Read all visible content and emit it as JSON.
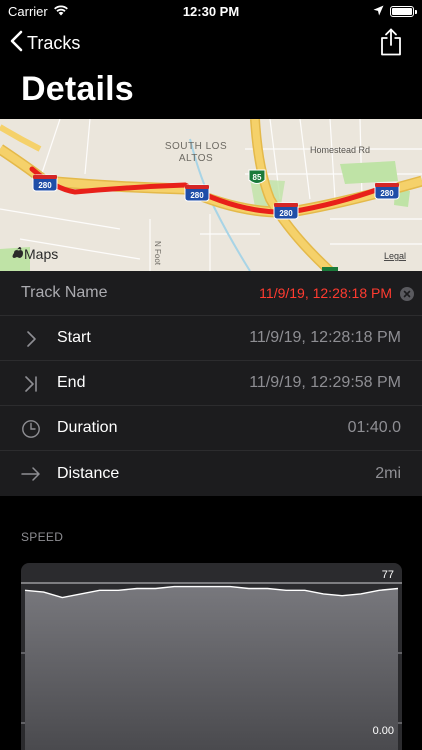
{
  "status_bar": {
    "carrier": "Carrier",
    "time": "12:30 PM"
  },
  "nav": {
    "back_label": "Tracks",
    "title": "Details"
  },
  "map": {
    "labels": {
      "area": [
        "SOUTH LOS",
        "ALTOS"
      ],
      "road": "Homestead Rd",
      "street": "N Foot",
      "shield_280_a": "280",
      "shield_280_b": "280",
      "shield_280_c": "280",
      "shield_280_d": "280",
      "shield_85": "85",
      "attribution": "Maps",
      "legal": "Legal"
    },
    "colors": {
      "track": "#e8201a",
      "highway": "#f5d16a",
      "land": "#ebe6dc",
      "green": "#bfe3a6",
      "water": "#a8d4e6"
    }
  },
  "details": {
    "track_name_label": "Track Name",
    "track_name_value": "11/9/19, 12:28:18 PM",
    "rows": [
      {
        "icon": "chevron-right-icon",
        "label": "Start",
        "value": "11/9/19, 12:28:18 PM"
      },
      {
        "icon": "skip-end-icon",
        "label": "End",
        "value": "11/9/19, 12:29:58 PM"
      },
      {
        "icon": "clock-icon",
        "label": "Duration",
        "value": "01:40.0"
      },
      {
        "icon": "arrow-right-icon",
        "label": "Distance",
        "value": "2mi"
      }
    ]
  },
  "speed": {
    "section_label": "SPEED",
    "y_max_label": "77",
    "y_min_label": "0.00"
  },
  "chart_data": {
    "type": "area",
    "title": "",
    "xlabel": "",
    "ylabel": "",
    "ylim": [
      0,
      77
    ],
    "grid": true,
    "x": [
      0,
      5,
      10,
      15,
      20,
      25,
      30,
      35,
      40,
      45,
      50,
      55,
      60,
      65,
      70,
      75,
      80,
      85,
      90,
      95,
      100
    ],
    "series": [
      {
        "values": [
          73,
          72,
          69,
          71,
          73,
          73,
          74,
          74,
          75,
          75,
          75,
          75,
          74,
          74,
          73,
          73,
          71,
          70,
          71,
          73,
          74
        ]
      }
    ]
  },
  "colors": {
    "accent_red": "#ff3b30",
    "secondary_text": "#8e8e93",
    "row_bg": "#1c1c1e",
    "chart_bg": "#2b2b2e"
  }
}
